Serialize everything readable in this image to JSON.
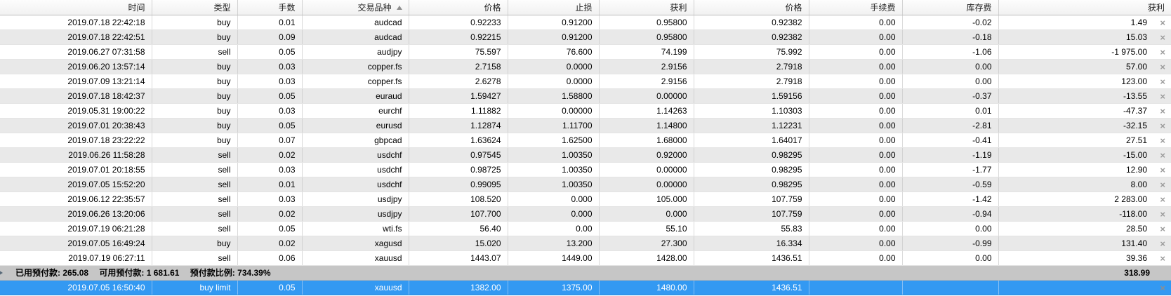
{
  "colors": {
    "selected_row_bg": "#3399f2",
    "summary_row_bg": "#c6c6c6",
    "alt_row_bg": "#e9e9e9",
    "header_bg": "#f5f5f5",
    "close_icon": "#9c9c9c"
  },
  "icons": {
    "close": "×"
  },
  "table": {
    "columns": [
      {
        "key": "time",
        "label": "时间"
      },
      {
        "key": "type",
        "label": "类型"
      },
      {
        "key": "lots",
        "label": "手数"
      },
      {
        "key": "symbol",
        "label": "交易品种",
        "sorted": "asc"
      },
      {
        "key": "price",
        "label": "价格"
      },
      {
        "key": "sl",
        "label": "止损"
      },
      {
        "key": "tp",
        "label": "获利"
      },
      {
        "key": "price2",
        "label": "价格"
      },
      {
        "key": "commission",
        "label": "手续费"
      },
      {
        "key": "swap",
        "label": "库存费"
      },
      {
        "key": "profit",
        "label": "获利"
      }
    ],
    "rows": [
      {
        "time": "2019.07.18 22:42:18",
        "type": "buy",
        "lots": "0.01",
        "symbol": "audcad",
        "price": "0.92233",
        "sl": "0.91200",
        "tp": "0.95800",
        "price2": "0.92382",
        "commission": "0.00",
        "swap": "-0.02",
        "profit": "1.49"
      },
      {
        "time": "2019.07.18 22:42:51",
        "type": "buy",
        "lots": "0.09",
        "symbol": "audcad",
        "price": "0.92215",
        "sl": "0.91200",
        "tp": "0.95800",
        "price2": "0.92382",
        "commission": "0.00",
        "swap": "-0.18",
        "profit": "15.03"
      },
      {
        "time": "2019.06.27 07:31:58",
        "type": "sell",
        "lots": "0.05",
        "symbol": "audjpy",
        "price": "75.597",
        "sl": "76.600",
        "tp": "74.199",
        "price2": "75.992",
        "commission": "0.00",
        "swap": "-1.06",
        "profit": "-1 975.00"
      },
      {
        "time": "2019.06.20 13:57:14",
        "type": "buy",
        "lots": "0.03",
        "symbol": "copper.fs",
        "price": "2.7158",
        "sl": "0.0000",
        "tp": "2.9156",
        "price2": "2.7918",
        "commission": "0.00",
        "swap": "0.00",
        "profit": "57.00"
      },
      {
        "time": "2019.07.09 13:21:14",
        "type": "buy",
        "lots": "0.03",
        "symbol": "copper.fs",
        "price": "2.6278",
        "sl": "0.0000",
        "tp": "2.9156",
        "price2": "2.7918",
        "commission": "0.00",
        "swap": "0.00",
        "profit": "123.00"
      },
      {
        "time": "2019.07.18 18:42:37",
        "type": "buy",
        "lots": "0.05",
        "symbol": "euraud",
        "price": "1.59427",
        "sl": "1.58800",
        "tp": "0.00000",
        "price2": "1.59156",
        "commission": "0.00",
        "swap": "-0.37",
        "profit": "-13.55"
      },
      {
        "time": "2019.05.31 19:00:22",
        "type": "buy",
        "lots": "0.03",
        "symbol": "eurchf",
        "price": "1.11882",
        "sl": "0.00000",
        "tp": "1.14263",
        "price2": "1.10303",
        "commission": "0.00",
        "swap": "0.01",
        "profit": "-47.37"
      },
      {
        "time": "2019.07.01 20:38:43",
        "type": "buy",
        "lots": "0.05",
        "symbol": "eurusd",
        "price": "1.12874",
        "sl": "1.11700",
        "tp": "1.14800",
        "price2": "1.12231",
        "commission": "0.00",
        "swap": "-2.81",
        "profit": "-32.15"
      },
      {
        "time": "2019.07.18 23:22:22",
        "type": "buy",
        "lots": "0.07",
        "symbol": "gbpcad",
        "price": "1.63624",
        "sl": "1.62500",
        "tp": "1.68000",
        "price2": "1.64017",
        "commission": "0.00",
        "swap": "-0.41",
        "profit": "27.51"
      },
      {
        "time": "2019.06.26 11:58:28",
        "type": "sell",
        "lots": "0.02",
        "symbol": "usdchf",
        "price": "0.97545",
        "sl": "1.00350",
        "tp": "0.92000",
        "price2": "0.98295",
        "commission": "0.00",
        "swap": "-1.19",
        "profit": "-15.00"
      },
      {
        "time": "2019.07.01 20:18:55",
        "type": "sell",
        "lots": "0.03",
        "symbol": "usdchf",
        "price": "0.98725",
        "sl": "1.00350",
        "tp": "0.00000",
        "price2": "0.98295",
        "commission": "0.00",
        "swap": "-1.77",
        "profit": "12.90"
      },
      {
        "time": "2019.07.05 15:52:20",
        "type": "sell",
        "lots": "0.01",
        "symbol": "usdchf",
        "price": "0.99095",
        "sl": "1.00350",
        "tp": "0.00000",
        "price2": "0.98295",
        "commission": "0.00",
        "swap": "-0.59",
        "profit": "8.00"
      },
      {
        "time": "2019.06.12 22:35:57",
        "type": "sell",
        "lots": "0.03",
        "symbol": "usdjpy",
        "price": "108.520",
        "sl": "0.000",
        "tp": "105.000",
        "price2": "107.759",
        "commission": "0.00",
        "swap": "-1.42",
        "profit": "2 283.00"
      },
      {
        "time": "2019.06.26 13:20:06",
        "type": "sell",
        "lots": "0.02",
        "symbol": "usdjpy",
        "price": "107.700",
        "sl": "0.000",
        "tp": "0.000",
        "price2": "107.759",
        "commission": "0.00",
        "swap": "-0.94",
        "profit": "-118.00"
      },
      {
        "time": "2019.07.19 06:21:28",
        "type": "sell",
        "lots": "0.05",
        "symbol": "wti.fs",
        "price": "56.40",
        "sl": "0.00",
        "tp": "55.10",
        "price2": "55.83",
        "commission": "0.00",
        "swap": "0.00",
        "profit": "28.50"
      },
      {
        "time": "2019.07.05 16:49:24",
        "type": "buy",
        "lots": "0.02",
        "symbol": "xagusd",
        "price": "15.020",
        "sl": "13.200",
        "tp": "27.300",
        "price2": "16.334",
        "commission": "0.00",
        "swap": "-0.99",
        "profit": "131.40"
      },
      {
        "time": "2019.07.19 06:27:11",
        "type": "sell",
        "lots": "0.06",
        "symbol": "xauusd",
        "price": "1443.07",
        "sl": "1449.00",
        "tp": "1428.00",
        "price2": "1436.51",
        "commission": "0.00",
        "swap": "0.00",
        "profit": "39.36"
      }
    ]
  },
  "summary": {
    "used_margin_label": "已用预付款:",
    "used_margin": "265.08",
    "free_margin_label": "可用预付款:",
    "free_margin": "1 681.61",
    "margin_level_label": "预付款比例:",
    "margin_level": "734.39%",
    "profit_total": "318.99"
  },
  "pending": {
    "time": "2019.07.05 16:50:40",
    "type": "buy limit",
    "lots": "0.05",
    "symbol": "xauusd",
    "price": "1382.00",
    "sl": "1375.00",
    "tp": "1480.00",
    "price2": "1436.51",
    "commission": "",
    "swap": "",
    "profit": ""
  }
}
